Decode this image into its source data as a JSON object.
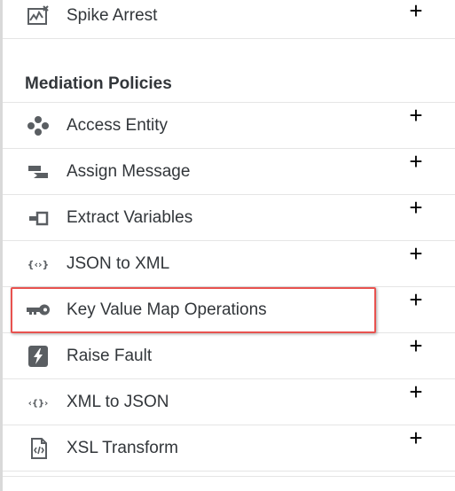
{
  "policies_top": [
    {
      "label": "Spike Arrest",
      "icon": "spike-arrest-icon",
      "add": "+"
    }
  ],
  "section": {
    "title": "Mediation Policies"
  },
  "mediation_policies": [
    {
      "label": "Access Entity",
      "icon": "access-entity-icon",
      "add": "+"
    },
    {
      "label": "Assign Message",
      "icon": "assign-message-icon",
      "add": "+"
    },
    {
      "label": "Extract Variables",
      "icon": "extract-variables-icon",
      "add": "+"
    },
    {
      "label": "JSON to XML",
      "icon": "json-to-xml-icon",
      "add": "+"
    },
    {
      "label": "Key Value Map Operations",
      "icon": "key-icon",
      "add": "+",
      "highlighted": true
    },
    {
      "label": "Raise Fault",
      "icon": "raise-fault-icon",
      "add": "+"
    },
    {
      "label": "XML to JSON",
      "icon": "xml-to-json-icon",
      "add": "+"
    },
    {
      "label": "XSL Transform",
      "icon": "xsl-transform-icon",
      "add": "+"
    }
  ],
  "colors": {
    "highlight_border": "#e8524f",
    "text": "#32363a",
    "icon": "#5a5e62"
  }
}
